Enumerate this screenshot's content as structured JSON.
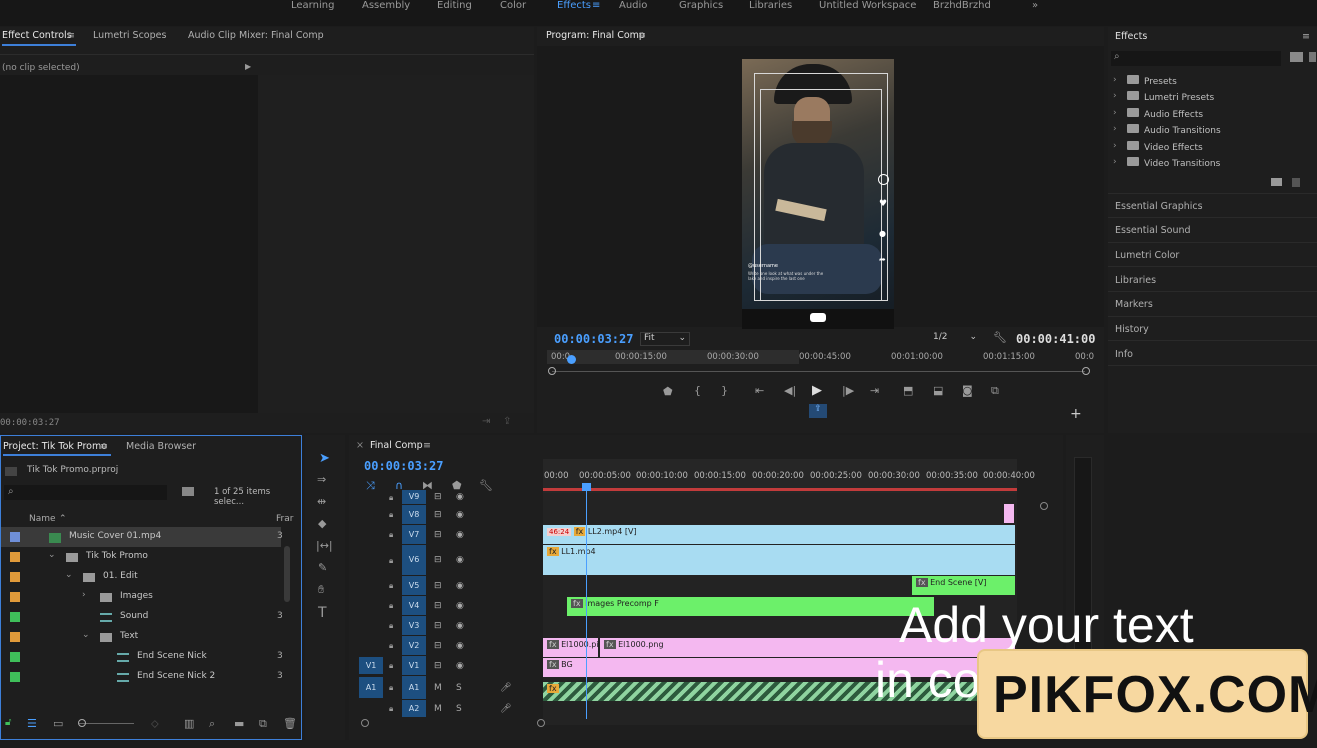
{
  "workspaces": [
    "Learning",
    "Assembly",
    "Editing",
    "Color",
    "Effects",
    "Audio",
    "Graphics",
    "Libraries",
    "Untitled Workspace",
    "BrzhdBrzhd",
    "»"
  ],
  "effect_controls": {
    "tabs": [
      "Effect Controls",
      "Lumetri Scopes",
      "Audio Clip Mixer: Final Comp"
    ],
    "no_clip": "(no clip selected)",
    "timecode": "00:00:03:27"
  },
  "program": {
    "title": "Program: Final Comp",
    "timecode": "00:00:03:27",
    "fit": "Fit",
    "resolution": "1/2",
    "duration": "00:00:41:00",
    "ruler": [
      "00:0",
      "00:00:15:00",
      "00:00:30:00",
      "00:00:45:00",
      "00:01:00:00",
      "00:01:15:00",
      "00:0"
    ],
    "video": {
      "username": "@username",
      "caption": "Write one look at what was under the lake and inspire the last one"
    }
  },
  "project": {
    "tabs": [
      "Project: Tik Tok Promo",
      "Media Browser"
    ],
    "file": "Tik Tok Promo.prproj",
    "count": "1 of 25 items selec...",
    "col_name": "Name",
    "col_fr": "Frar",
    "items": [
      {
        "label": "Music Cover 01.mp4",
        "indent": 0,
        "color": "#6f8fd8",
        "icon": "media-icon",
        "val": "3",
        "sel": true
      },
      {
        "label": "Tik Tok Promo",
        "indent": 1,
        "color": "#e09a3a",
        "icon": "folder-icon",
        "val": "",
        "open": true
      },
      {
        "label": "01. Edit",
        "indent": 2,
        "color": "#e09a3a",
        "icon": "folder-icon",
        "val": "",
        "open": true
      },
      {
        "label": "Images",
        "indent": 3,
        "color": "#e09a3a",
        "icon": "folder-icon",
        "val": "",
        "closed": true
      },
      {
        "label": "Sound",
        "indent": 3,
        "color": "#3fbf5a",
        "icon": "sequence-icon",
        "val": "3"
      },
      {
        "label": "Text",
        "indent": 3,
        "color": "#e09a3a",
        "icon": "folder-icon",
        "val": "",
        "open": true
      },
      {
        "label": "End Scene Nick",
        "indent": 4,
        "color": "#3fbf5a",
        "icon": "sequence-icon",
        "val": "3"
      },
      {
        "label": "End Scene Nick 2",
        "indent": 4,
        "color": "#3fbf5a",
        "icon": "sequence-icon",
        "val": "3"
      }
    ]
  },
  "timeline": {
    "title": "Final Comp",
    "timecode": "00:00:03:27",
    "ruler": [
      "00:00",
      "00:00:05:00",
      "00:00:10:00",
      "00:00:15:00",
      "00:00:20:00",
      "00:00:25:00",
      "00:00:30:00",
      "00:00:35:00",
      "00:00:40:00"
    ],
    "tracks": [
      "V9",
      "V8",
      "V7",
      "V6",
      "V5",
      "V4",
      "V3",
      "V2",
      "V1",
      "A1",
      "A2"
    ],
    "src_v1": "V1",
    "src_a1": "A1",
    "clips": {
      "ll2": "LL2.mp4 [V]",
      "ll2_badge": "46:24",
      "ll1": "LL1.mp4",
      "endscene": "End Scene [V]",
      "images": "Images Precomp F",
      "el1": "El1000.pi",
      "el2": "El1000.png",
      "bg": "BG"
    }
  },
  "effects": {
    "title": "Effects",
    "folders": [
      "Presets",
      "Lumetri Presets",
      "Audio Effects",
      "Audio Transitions",
      "Video Effects",
      "Video Transitions"
    ],
    "panels": [
      "Essential Graphics",
      "Essential Sound",
      "Lumetri Color",
      "Libraries",
      "Markers",
      "History",
      "Info"
    ]
  },
  "overlay": {
    "line1": "Add your text",
    "line2": "in co",
    "logo": "PIKFOX.COM"
  },
  "colors": {
    "accent": "#4a9fff",
    "clip_blue": "#a8dcf2",
    "clip_green": "#6cf06a",
    "clip_pink": "#f4b8f0",
    "track_blue": "#1d4f80"
  }
}
